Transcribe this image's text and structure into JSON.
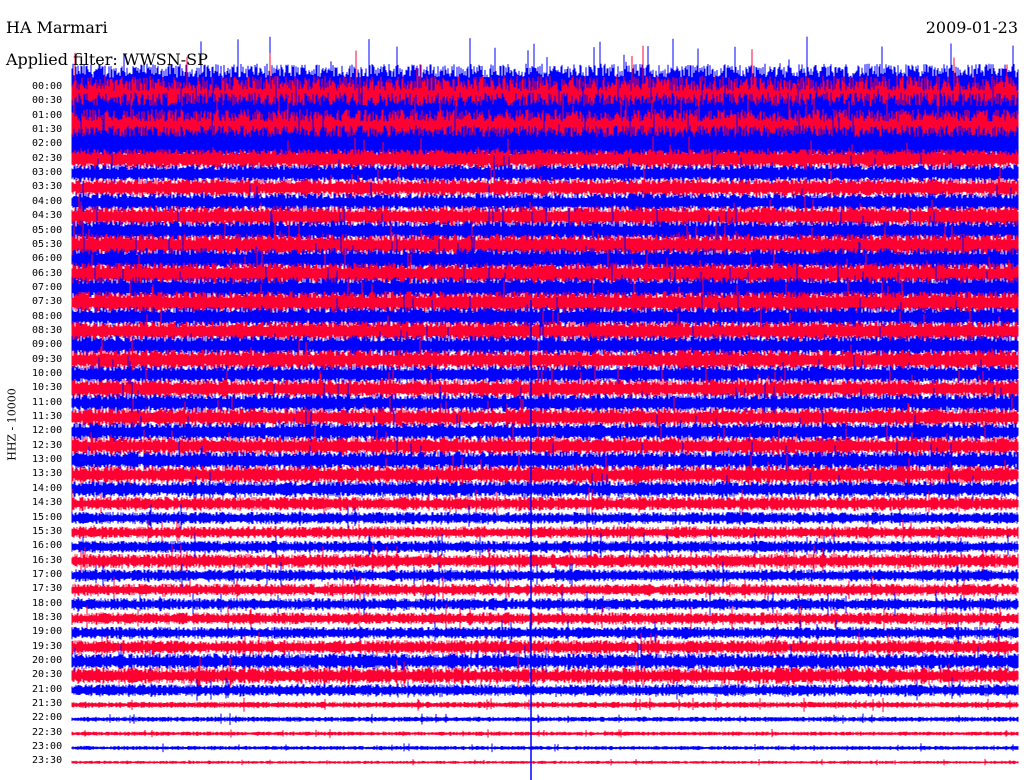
{
  "header": {
    "station": "HA Marmari",
    "date": "2009-01-23",
    "filter": "Applied filter: WWSN-SP"
  },
  "axis": {
    "ylabel": "HHZ - 10000"
  },
  "rows": [
    {
      "time": "00:00",
      "color": "#0000ff",
      "amp": 2.2
    },
    {
      "time": "00:30",
      "color": "#ff0033",
      "amp": 2.4
    },
    {
      "time": "01:00",
      "color": "#0000ff",
      "amp": 2.2
    },
    {
      "time": "01:30",
      "color": "#ff0033",
      "amp": 2.0
    },
    {
      "time": "02:00",
      "color": "#0000ff",
      "amp": 1.8
    },
    {
      "time": "02:30",
      "color": "#ff0033",
      "amp": 1.0
    },
    {
      "time": "03:00",
      "color": "#0000ff",
      "amp": 0.9
    },
    {
      "time": "03:30",
      "color": "#ff0033",
      "amp": 0.9
    },
    {
      "time": "04:00",
      "color": "#0000ff",
      "amp": 0.9
    },
    {
      "time": "04:30",
      "color": "#ff0033",
      "amp": 1.0
    },
    {
      "time": "05:00",
      "color": "#0000ff",
      "amp": 1.0
    },
    {
      "time": "05:30",
      "color": "#ff0033",
      "amp": 1.1
    },
    {
      "time": "06:00",
      "color": "#0000ff",
      "amp": 1.1
    },
    {
      "time": "06:30",
      "color": "#ff0033",
      "amp": 1.1
    },
    {
      "time": "07:00",
      "color": "#0000ff",
      "amp": 1.1
    },
    {
      "time": "07:30",
      "color": "#ff0033",
      "amp": 1.1
    },
    {
      "time": "08:00",
      "color": "#0000ff",
      "amp": 1.0
    },
    {
      "time": "08:30",
      "color": "#ff0033",
      "amp": 1.0
    },
    {
      "time": "09:00",
      "color": "#0000ff",
      "amp": 1.0
    },
    {
      "time": "09:30",
      "color": "#ff0033",
      "amp": 1.0
    },
    {
      "time": "10:00",
      "color": "#0000ff",
      "amp": 0.9
    },
    {
      "time": "10:30",
      "color": "#ff0033",
      "amp": 0.9
    },
    {
      "time": "11:00",
      "color": "#0000ff",
      "amp": 0.9
    },
    {
      "time": "11:30",
      "color": "#ff0033",
      "amp": 0.9
    },
    {
      "time": "12:00",
      "color": "#0000ff",
      "amp": 0.9
    },
    {
      "time": "12:30",
      "color": "#ff0033",
      "amp": 0.9
    },
    {
      "time": "13:00",
      "color": "#0000ff",
      "amp": 0.9
    },
    {
      "time": "13:30",
      "color": "#ff0033",
      "amp": 0.9
    },
    {
      "time": "14:00",
      "color": "#0000ff",
      "amp": 0.8
    },
    {
      "time": "14:30",
      "color": "#ff0033",
      "amp": 0.7
    },
    {
      "time": "15:00",
      "color": "#0000ff",
      "amp": 0.6
    },
    {
      "time": "15:30",
      "color": "#ff0033",
      "amp": 0.6
    },
    {
      "time": "16:00",
      "color": "#0000ff",
      "amp": 0.6
    },
    {
      "time": "16:30",
      "color": "#ff0033",
      "amp": 0.7
    },
    {
      "time": "17:00",
      "color": "#0000ff",
      "amp": 0.6
    },
    {
      "time": "17:30",
      "color": "#ff0033",
      "amp": 0.6
    },
    {
      "time": "18:00",
      "color": "#0000ff",
      "amp": 0.6
    },
    {
      "time": "18:30",
      "color": "#ff0033",
      "amp": 0.6
    },
    {
      "time": "19:00",
      "color": "#0000ff",
      "amp": 0.6
    },
    {
      "time": "19:30",
      "color": "#ff0033",
      "amp": 0.7
    },
    {
      "time": "20:00",
      "color": "#0000ff",
      "amp": 0.8
    },
    {
      "time": "20:30",
      "color": "#ff0033",
      "amp": 0.8
    },
    {
      "time": "21:00",
      "color": "#0000ff",
      "amp": 0.6
    },
    {
      "time": "21:30",
      "color": "#ff0033",
      "amp": 0.3
    },
    {
      "time": "22:00",
      "color": "#0000ff",
      "amp": 0.25
    },
    {
      "time": "22:30",
      "color": "#ff0033",
      "amp": 0.2
    },
    {
      "time": "23:00",
      "color": "#0000ff",
      "amp": 0.2
    },
    {
      "time": "23:30",
      "color": "#ff0033",
      "amp": 0.15
    }
  ]
}
